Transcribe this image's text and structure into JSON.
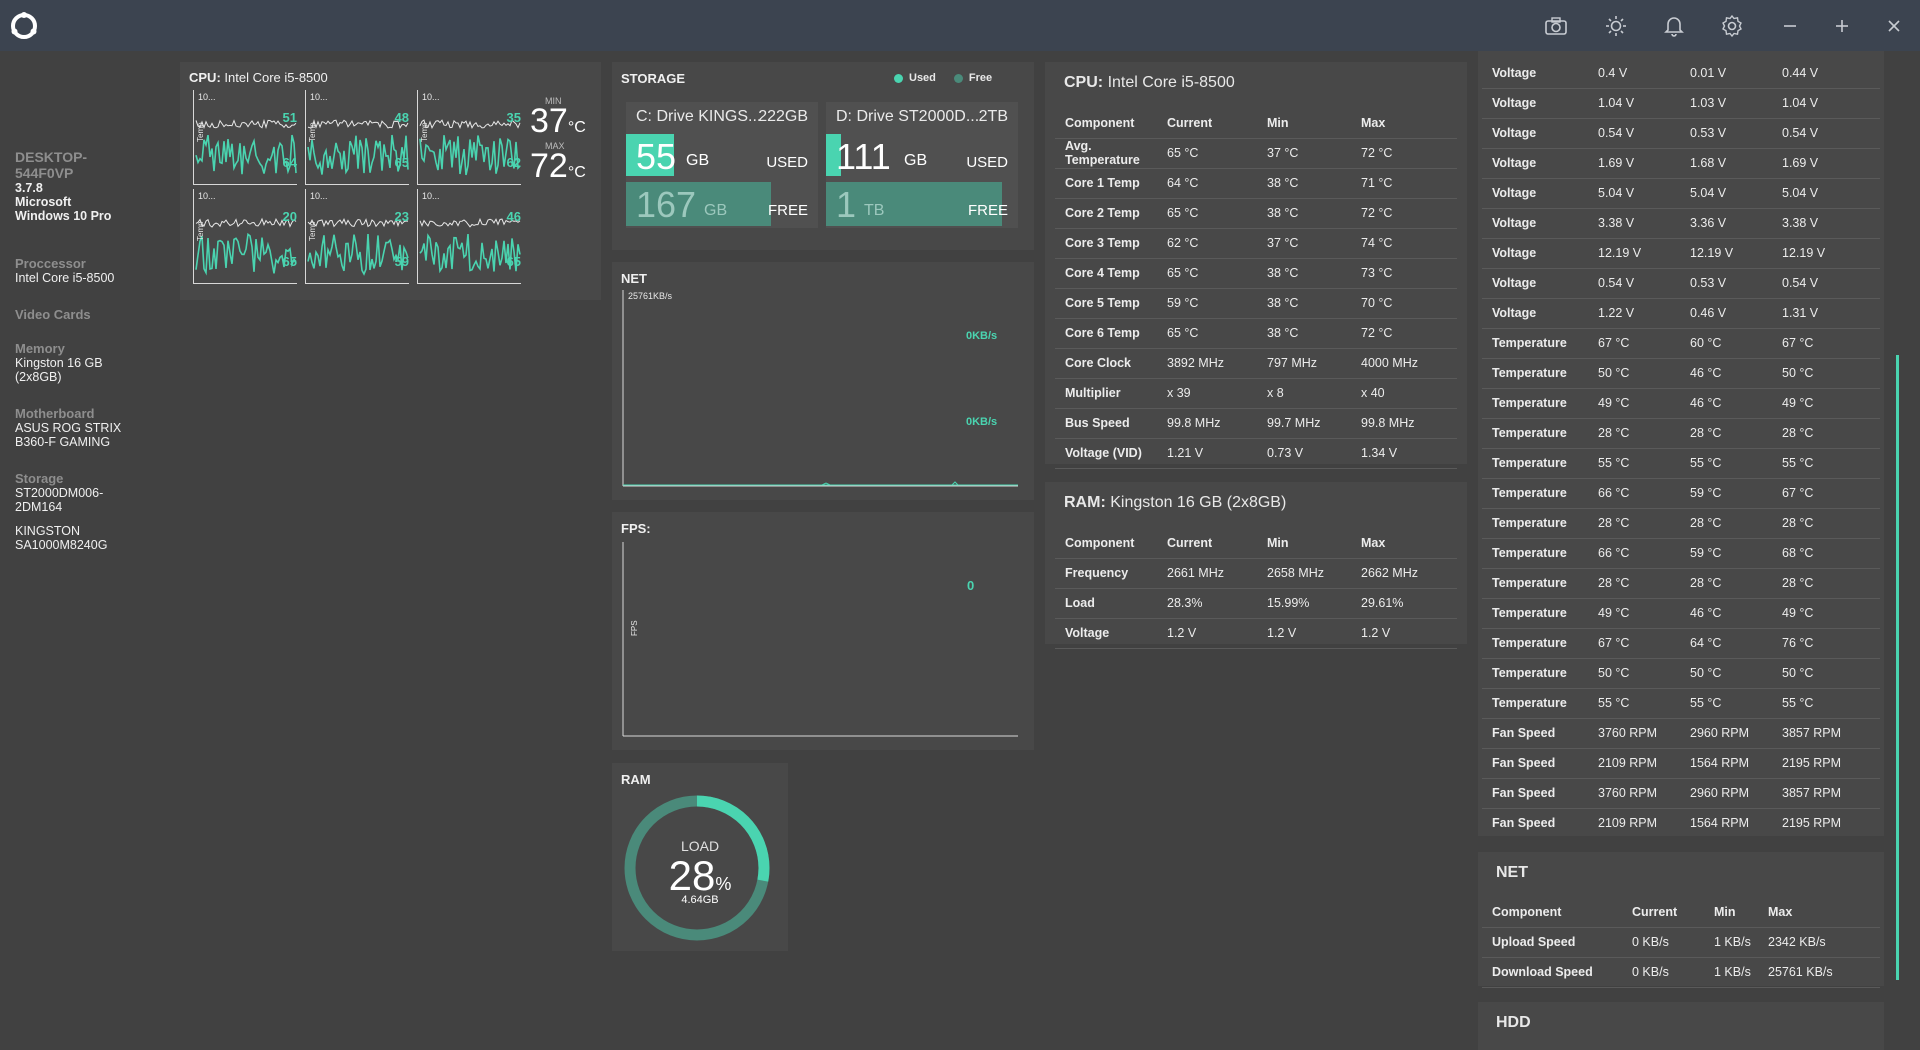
{
  "sidebar": {
    "hostname": "DESKTOP-544F0VP",
    "version": "3.7.8",
    "os": "Microsoft Windows 10 Pro",
    "processor_label": "Proccessor",
    "processor": "Intel Core i5-8500",
    "video_label": "Video Cards",
    "memory_label": "Memory",
    "memory": "Kingston 16 GB (2x8GB)",
    "motherboard_label": "Motherboard",
    "motherboard": "ASUS ROG STRIX B360-F GAMING",
    "storage_label": "Storage",
    "storage": [
      "ST2000DM006-2DM164",
      "KINGSTON SA1000M8240G"
    ]
  },
  "cpu_panel": {
    "title_prefix": "CPU:",
    "title": "Intel Core i5-8500",
    "min_label": "MIN",
    "min_value": "37",
    "max_label": "MAX",
    "max_value": "72",
    "unit": "°C",
    "cores": [
      {
        "top": "10...",
        "ylabel": "Temp",
        "v1": "51",
        "v2": "64"
      },
      {
        "top": "10...",
        "ylabel": "Temp",
        "v1": "48",
        "v2": "65"
      },
      {
        "top": "10...",
        "ylabel": "Temp",
        "v1": "35",
        "v2": "62"
      },
      {
        "top": "10...",
        "ylabel": "Temp",
        "v1": "20",
        "v2": "65"
      },
      {
        "top": "10...",
        "ylabel": "Temp",
        "v1": "23",
        "v2": "59"
      },
      {
        "top": "10...",
        "ylabel": "",
        "v1": "46",
        "v2": "65"
      }
    ]
  },
  "storage": {
    "title": "STORAGE",
    "legend_used": "Used",
    "legend_free": "Free",
    "drives": [
      {
        "name": "C: Drive KINGS...",
        "size": "222GB",
        "used": "55",
        "used_unit": "GB",
        "free": "167",
        "free_unit": "GB",
        "used_fraction": 0.25
      },
      {
        "name": "D: Drive ST2000D...",
        "size": "2TB",
        "used": "111",
        "used_unit": "GB",
        "free": "1",
        "free_unit": "TB",
        "used_fraction": 0.08
      }
    ],
    "used_label": "USED",
    "free_label": "FREE"
  },
  "net_panel": {
    "title": "NET",
    "scale": "25761KB/s",
    "upload": "0KB/s",
    "download": "0KB/s"
  },
  "fps_panel": {
    "title": "FPS:",
    "ylabel": "FPS",
    "value": "0"
  },
  "ram_panel": {
    "title": "RAM",
    "load_label": "LOAD",
    "load_value": "28",
    "load_unit": "%",
    "used": "4.64GB",
    "load_fraction": 0.28
  },
  "cpu_table": {
    "title_prefix": "CPU:",
    "title": "Intel Core i5-8500",
    "headers": [
      "Component",
      "Current",
      "Min",
      "Max"
    ],
    "rows": [
      [
        "Avg. Temperature",
        "65 °C",
        "37 °C",
        "72 °C"
      ],
      [
        "Core 1 Temp",
        "64 °C",
        "38 °C",
        "71 °C"
      ],
      [
        "Core 2 Temp",
        "65 °C",
        "38 °C",
        "72 °C"
      ],
      [
        "Core 3 Temp",
        "62 °C",
        "37 °C",
        "74 °C"
      ],
      [
        "Core 4 Temp",
        "65 °C",
        "38 °C",
        "73 °C"
      ],
      [
        "Core 5 Temp",
        "59 °C",
        "38 °C",
        "70 °C"
      ],
      [
        "Core 6 Temp",
        "65 °C",
        "38 °C",
        "72 °C"
      ],
      [
        "Core Clock",
        "3892 MHz",
        "797 MHz",
        "4000 MHz"
      ],
      [
        "Multiplier",
        "x 39",
        "x 8",
        "x 40"
      ],
      [
        "Bus Speed",
        "99.8 MHz",
        "99.7 MHz",
        "99.8 MHz"
      ],
      [
        "Voltage (VID)",
        "1.21 V",
        "0.73 V",
        "1.34 V"
      ]
    ]
  },
  "ram_table": {
    "title_prefix": "RAM:",
    "title": "Kingston 16 GB (2x8GB)",
    "headers": [
      "Component",
      "Current",
      "Min",
      "Max"
    ],
    "rows": [
      [
        "Frequency",
        "2661 MHz",
        "2658 MHz",
        "2662 MHz"
      ],
      [
        "Load",
        "28.3%",
        "15.99%",
        "29.61%"
      ],
      [
        "Voltage",
        "1.2 V",
        "1.2 V",
        "1.2 V"
      ]
    ]
  },
  "mb_table": {
    "rows": [
      [
        "Voltage",
        "0.4 V",
        "0.01 V",
        "0.44 V"
      ],
      [
        "Voltage",
        "1.04 V",
        "1.03 V",
        "1.04 V"
      ],
      [
        "Voltage",
        "0.54 V",
        "0.53 V",
        "0.54 V"
      ],
      [
        "Voltage",
        "1.69 V",
        "1.68 V",
        "1.69 V"
      ],
      [
        "Voltage",
        "5.04 V",
        "5.04 V",
        "5.04 V"
      ],
      [
        "Voltage",
        "3.38 V",
        "3.36 V",
        "3.38 V"
      ],
      [
        "Voltage",
        "12.19 V",
        "12.19 V",
        "12.19 V"
      ],
      [
        "Voltage",
        "0.54 V",
        "0.53 V",
        "0.54 V"
      ],
      [
        "Voltage",
        "1.22 V",
        "0.46 V",
        "1.31 V"
      ],
      [
        "Temperature",
        "67 °C",
        "60 °C",
        "67 °C"
      ],
      [
        "Temperature",
        "50 °C",
        "46 °C",
        "50 °C"
      ],
      [
        "Temperature",
        "49 °C",
        "46 °C",
        "49 °C"
      ],
      [
        "Temperature",
        "28 °C",
        "28 °C",
        "28 °C"
      ],
      [
        "Temperature",
        "55 °C",
        "55 °C",
        "55 °C"
      ],
      [
        "Temperature",
        "66 °C",
        "59 °C",
        "67 °C"
      ],
      [
        "Temperature",
        "28 °C",
        "28 °C",
        "28 °C"
      ],
      [
        "Temperature",
        "66 °C",
        "59 °C",
        "68 °C"
      ],
      [
        "Temperature",
        "28 °C",
        "28 °C",
        "28 °C"
      ],
      [
        "Temperature",
        "49 °C",
        "46 °C",
        "49 °C"
      ],
      [
        "Temperature",
        "67 °C",
        "64 °C",
        "76 °C"
      ],
      [
        "Temperature",
        "50 °C",
        "50 °C",
        "50 °C"
      ],
      [
        "Temperature",
        "55 °C",
        "55 °C",
        "55 °C"
      ],
      [
        "Fan Speed",
        "3760 RPM",
        "2960 RPM",
        "3857 RPM"
      ],
      [
        "Fan Speed",
        "2109 RPM",
        "1564 RPM",
        "2195 RPM"
      ],
      [
        "Fan Speed",
        "3760 RPM",
        "2960 RPM",
        "3857 RPM"
      ],
      [
        "Fan Speed",
        "2109 RPM",
        "1564 RPM",
        "2195 RPM"
      ]
    ]
  },
  "net_table": {
    "title": "NET",
    "headers": [
      "Component",
      "Current",
      "Min",
      "Max"
    ],
    "rows": [
      [
        "Upload Speed",
        "0 KB/s",
        "1 KB/s",
        "2342 KB/s"
      ],
      [
        "Download Speed",
        "0 KB/s",
        "1 KB/s",
        "25761 KB/s"
      ]
    ]
  },
  "hdd_table": {
    "title": "HDD"
  },
  "colors": {
    "accent": "#4ad4b0",
    "titlebar": "#3c4450",
    "background": "#414141",
    "panel": "#484848"
  },
  "icons": [
    "app-logo-icon",
    "camera-icon",
    "brightness-icon",
    "bell-icon",
    "gear-icon",
    "minimize-icon",
    "maximize-icon",
    "close-icon"
  ]
}
